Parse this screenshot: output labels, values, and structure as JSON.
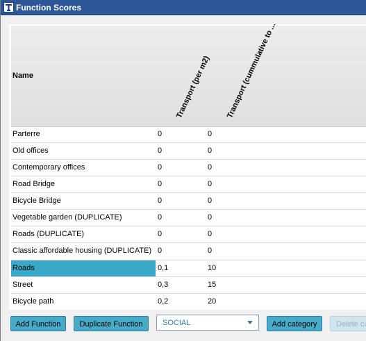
{
  "window": {
    "title": "Function Scores"
  },
  "table": {
    "columns": {
      "name": "Name",
      "col1": "Transport  (per m2)",
      "col2": "Transport (cummulative to ..."
    },
    "rows": [
      {
        "name": "Parterre",
        "v1": "0",
        "v2": "0"
      },
      {
        "name": "Old offices",
        "v1": "0",
        "v2": "0"
      },
      {
        "name": "Contemporary offices",
        "v1": "0",
        "v2": "0"
      },
      {
        "name": "Road Bridge",
        "v1": "0",
        "v2": "0"
      },
      {
        "name": "Bicycle Bridge",
        "v1": "0",
        "v2": "0"
      },
      {
        "name": "Vegetable garden (DUPLICATE)",
        "v1": "0",
        "v2": "0"
      },
      {
        "name": "Roads (DUPLICATE)",
        "v1": "0",
        "v2": "0"
      },
      {
        "name": "Classic affordable housing (DUPLICATE)",
        "v1": "0",
        "v2": "0"
      },
      {
        "name": "Roads",
        "v1": "0,1",
        "v2": "10"
      },
      {
        "name": "Street",
        "v1": "0,3",
        "v2": "15"
      },
      {
        "name": "Bicycle path",
        "v1": "0,2",
        "v2": "20"
      }
    ]
  },
  "footer": {
    "add_function": "Add Function",
    "duplicate_function": "Duplicate Function",
    "category_select": "SOCIAL",
    "add_category": "Add category",
    "delete_category": "Delete ca"
  },
  "colors": {
    "titlebar": "#2d5697",
    "selection": "#3aa8c8",
    "button": "#47aac8"
  }
}
